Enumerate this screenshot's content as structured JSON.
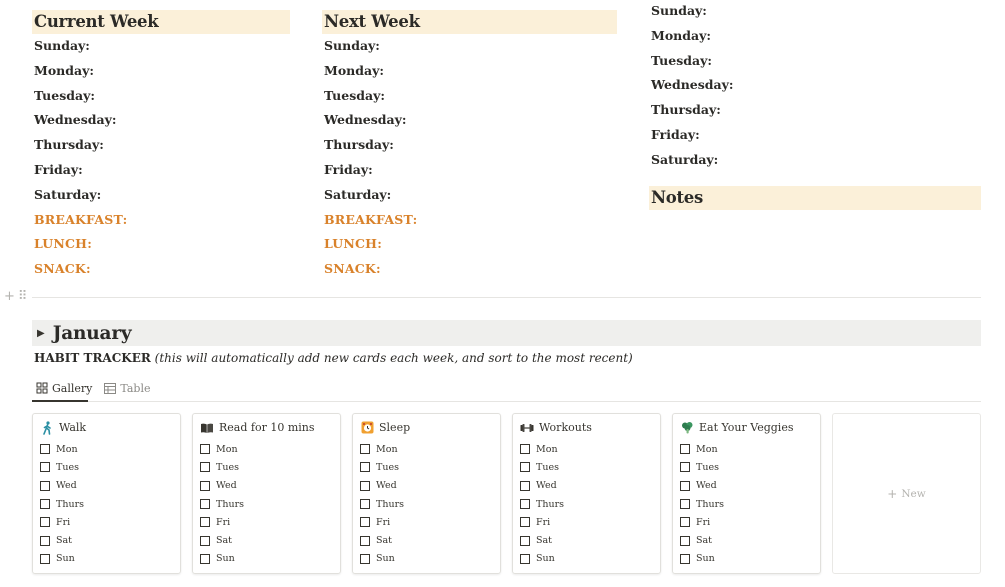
{
  "meal_plan": {
    "current_week": {
      "title": "Current Week",
      "days": [
        "Sunday:",
        "Monday:",
        "Tuesday:",
        "Wednesday:",
        "Thursday:",
        "Friday:",
        "Saturday:"
      ],
      "meals": [
        "BREAKFAST:",
        "LUNCH:",
        "SNACK:"
      ]
    },
    "next_week": {
      "title": "Next Week",
      "days": [
        "Sunday:",
        "Monday:",
        "Tuesday:",
        "Wednesday:",
        "Thursday:",
        "Friday:",
        "Saturday:"
      ],
      "meals": [
        "BREAKFAST:",
        "LUNCH:",
        "SNACK:"
      ]
    },
    "third_column": {
      "days": [
        "Sunday:",
        "Monday:",
        "Tuesday:",
        "Wednesday:",
        "Thursday:",
        "Friday:",
        "Saturday:"
      ],
      "notes_title": "Notes"
    }
  },
  "gutter": {
    "add_icon": "plus-icon",
    "drag_icon": "drag-handle-icon",
    "add_glyph": "+",
    "drag_glyph": "⠿"
  },
  "month_toggle": {
    "title": "January",
    "arrow_glyph": "▶"
  },
  "habit_tracker": {
    "title": "HABIT TRACKER",
    "note": "(this will automatically add new cards each week, and sort to the most recent)",
    "views": [
      {
        "label": "Gallery",
        "icon": "gallery-icon",
        "active": true
      },
      {
        "label": "Table",
        "icon": "table-icon",
        "active": false
      }
    ],
    "cards": [
      {
        "title": "Walk",
        "icon": "walking-person-icon",
        "days": [
          "Mon",
          "Tues",
          "Wed",
          "Thurs",
          "Fri",
          "Sat",
          "Sun"
        ]
      },
      {
        "title": "Read for 10 mins",
        "icon": "open-book-icon",
        "days": [
          "Mon",
          "Tues",
          "Wed",
          "Thurs",
          "Fri",
          "Sat",
          "Sun"
        ]
      },
      {
        "title": "Sleep",
        "icon": "alarm-clock-icon",
        "days": [
          "Mon",
          "Tues",
          "Wed",
          "Thurs",
          "Fri",
          "Sat",
          "Sun"
        ]
      },
      {
        "title": "Workouts",
        "icon": "dumbbell-icon",
        "days": [
          "Mon",
          "Tues",
          "Wed",
          "Thurs",
          "Fri",
          "Sat",
          "Sun"
        ]
      },
      {
        "title": "Eat Your Veggies",
        "icon": "broccoli-icon",
        "days": [
          "Mon",
          "Tues",
          "Wed",
          "Thurs",
          "Fri",
          "Sat",
          "Sun"
        ]
      }
    ],
    "new_label": "New",
    "new_glyph": "+"
  },
  "colors": {
    "heading_bg": "#fbf0d9",
    "meal_label": "#d9822b",
    "toggle_bg": "#efefed",
    "text": "#37352f"
  }
}
